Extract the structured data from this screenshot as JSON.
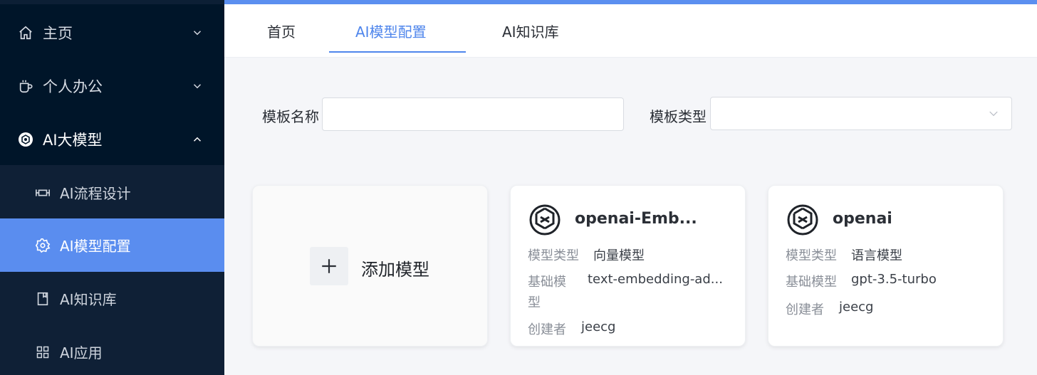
{
  "sidebar": {
    "items": [
      {
        "label": "主页",
        "icon": "home-icon"
      },
      {
        "label": "个人办公",
        "icon": "cup-icon"
      },
      {
        "label": "AI大模型",
        "icon": "ai-icon"
      }
    ],
    "sub_items": [
      {
        "label": "AI流程设计",
        "icon": "flow-icon"
      },
      {
        "label": "AI模型配置",
        "icon": "gear-icon",
        "active": true
      },
      {
        "label": "AI知识库",
        "icon": "book-icon"
      },
      {
        "label": "AI应用",
        "icon": "grid-icon"
      }
    ]
  },
  "tabs": [
    {
      "label": "首页"
    },
    {
      "label": "AI模型配置",
      "active": true
    },
    {
      "label": "AI知识库"
    }
  ],
  "filter": {
    "name_label": "模板名称",
    "name_value": "",
    "type_label": "模板类型",
    "type_value": ""
  },
  "add_card": {
    "label": "添加模型"
  },
  "cards": [
    {
      "title": "openai-Emb...",
      "type_label": "模型类型",
      "type_value": "向量模型",
      "base_label_line1": "基础模",
      "base_label_line2": "型",
      "base_value": "text-embedding-ad...",
      "creator_label": "创建者",
      "creator_value": "jeecg"
    },
    {
      "title": "openai",
      "type_label": "模型类型",
      "type_value": "语言模型",
      "base_label": "基础模型",
      "base_value": "gpt-3.5-turbo",
      "creator_label": "创建者",
      "creator_value": "jeecg"
    }
  ],
  "colors": {
    "sidebar_bg": "#001529",
    "accent": "#5a8def",
    "tab_active": "#4f86ec"
  }
}
